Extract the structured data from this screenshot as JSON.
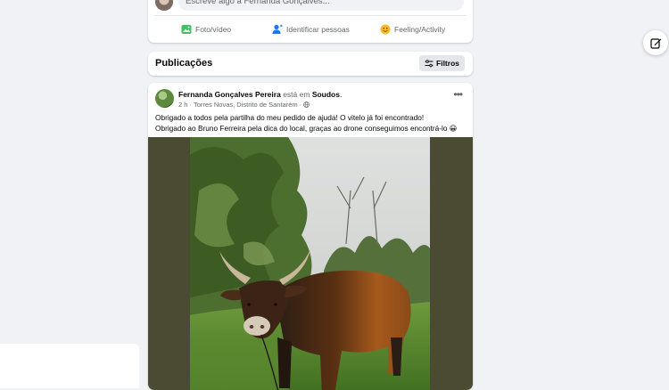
{
  "composer": {
    "placeholder": "Escreve algo a Fernanda Gonçalves...",
    "actions": [
      {
        "label": "Foto/vídeo",
        "icon": "photo-video-icon",
        "color": "#45bd62"
      },
      {
        "label": "Identificar pessoas",
        "icon": "tag-people-icon",
        "color": "#1877f2"
      },
      {
        "label": "Feeling/Activity",
        "icon": "smiley-icon",
        "color": "#f7b928"
      }
    ]
  },
  "publications": {
    "title": "Publicações",
    "filters_label": "Filtros"
  },
  "post": {
    "author": "Fernanda Gonçalves Pereira",
    "connector": "está em",
    "place": "Soudos",
    "time": "2 h",
    "location": "Torres Novas, Distrito de Santarém",
    "privacy_icon": "globe-icon",
    "lines": [
      "Obrigado a todos pela partilha do meu pedido de ajuda! O vitelo já foi encontrado!",
      "Obrigado ao Bruno Ferreira pela dica do local, graças ao drone conseguimos encontrá-lo"
    ],
    "emoji": "😀",
    "image_subject": "bull-photo"
  },
  "colors": {
    "page_bg": "#f0f2f5",
    "card_bg": "#ffffff",
    "muted_text": "#65676b",
    "photo_frame": "#4b4a33"
  }
}
